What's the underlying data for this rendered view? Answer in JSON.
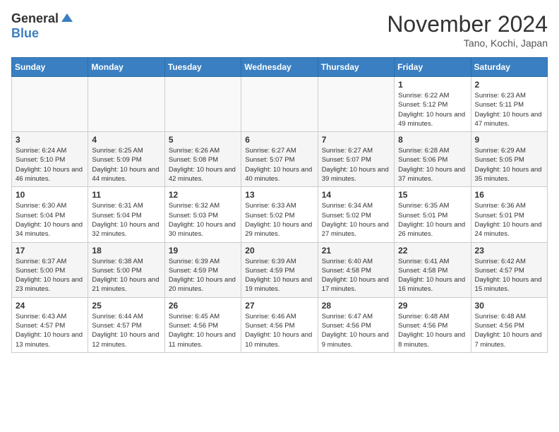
{
  "header": {
    "logo_general": "General",
    "logo_blue": "Blue",
    "month_title": "November 2024",
    "location": "Tano, Kochi, Japan"
  },
  "weekdays": [
    "Sunday",
    "Monday",
    "Tuesday",
    "Wednesday",
    "Thursday",
    "Friday",
    "Saturday"
  ],
  "weeks": [
    [
      {
        "day": "",
        "empty": true
      },
      {
        "day": "",
        "empty": true
      },
      {
        "day": "",
        "empty": true
      },
      {
        "day": "",
        "empty": true
      },
      {
        "day": "",
        "empty": true
      },
      {
        "day": "1",
        "sunrise": "6:22 AM",
        "sunset": "5:12 PM",
        "daylight": "10 hours and 49 minutes."
      },
      {
        "day": "2",
        "sunrise": "6:23 AM",
        "sunset": "5:11 PM",
        "daylight": "10 hours and 47 minutes."
      }
    ],
    [
      {
        "day": "3",
        "sunrise": "6:24 AM",
        "sunset": "5:10 PM",
        "daylight": "10 hours and 46 minutes."
      },
      {
        "day": "4",
        "sunrise": "6:25 AM",
        "sunset": "5:09 PM",
        "daylight": "10 hours and 44 minutes."
      },
      {
        "day": "5",
        "sunrise": "6:26 AM",
        "sunset": "5:08 PM",
        "daylight": "10 hours and 42 minutes."
      },
      {
        "day": "6",
        "sunrise": "6:27 AM",
        "sunset": "5:07 PM",
        "daylight": "10 hours and 40 minutes."
      },
      {
        "day": "7",
        "sunrise": "6:27 AM",
        "sunset": "5:07 PM",
        "daylight": "10 hours and 39 minutes."
      },
      {
        "day": "8",
        "sunrise": "6:28 AM",
        "sunset": "5:06 PM",
        "daylight": "10 hours and 37 minutes."
      },
      {
        "day": "9",
        "sunrise": "6:29 AM",
        "sunset": "5:05 PM",
        "daylight": "10 hours and 35 minutes."
      }
    ],
    [
      {
        "day": "10",
        "sunrise": "6:30 AM",
        "sunset": "5:04 PM",
        "daylight": "10 hours and 34 minutes."
      },
      {
        "day": "11",
        "sunrise": "6:31 AM",
        "sunset": "5:04 PM",
        "daylight": "10 hours and 32 minutes."
      },
      {
        "day": "12",
        "sunrise": "6:32 AM",
        "sunset": "5:03 PM",
        "daylight": "10 hours and 30 minutes."
      },
      {
        "day": "13",
        "sunrise": "6:33 AM",
        "sunset": "5:02 PM",
        "daylight": "10 hours and 29 minutes."
      },
      {
        "day": "14",
        "sunrise": "6:34 AM",
        "sunset": "5:02 PM",
        "daylight": "10 hours and 27 minutes."
      },
      {
        "day": "15",
        "sunrise": "6:35 AM",
        "sunset": "5:01 PM",
        "daylight": "10 hours and 26 minutes."
      },
      {
        "day": "16",
        "sunrise": "6:36 AM",
        "sunset": "5:01 PM",
        "daylight": "10 hours and 24 minutes."
      }
    ],
    [
      {
        "day": "17",
        "sunrise": "6:37 AM",
        "sunset": "5:00 PM",
        "daylight": "10 hours and 23 minutes."
      },
      {
        "day": "18",
        "sunrise": "6:38 AM",
        "sunset": "5:00 PM",
        "daylight": "10 hours and 21 minutes."
      },
      {
        "day": "19",
        "sunrise": "6:39 AM",
        "sunset": "4:59 PM",
        "daylight": "10 hours and 20 minutes."
      },
      {
        "day": "20",
        "sunrise": "6:39 AM",
        "sunset": "4:59 PM",
        "daylight": "10 hours and 19 minutes."
      },
      {
        "day": "21",
        "sunrise": "6:40 AM",
        "sunset": "4:58 PM",
        "daylight": "10 hours and 17 minutes."
      },
      {
        "day": "22",
        "sunrise": "6:41 AM",
        "sunset": "4:58 PM",
        "daylight": "10 hours and 16 minutes."
      },
      {
        "day": "23",
        "sunrise": "6:42 AM",
        "sunset": "4:57 PM",
        "daylight": "10 hours and 15 minutes."
      }
    ],
    [
      {
        "day": "24",
        "sunrise": "6:43 AM",
        "sunset": "4:57 PM",
        "daylight": "10 hours and 13 minutes."
      },
      {
        "day": "25",
        "sunrise": "6:44 AM",
        "sunset": "4:57 PM",
        "daylight": "10 hours and 12 minutes."
      },
      {
        "day": "26",
        "sunrise": "6:45 AM",
        "sunset": "4:56 PM",
        "daylight": "10 hours and 11 minutes."
      },
      {
        "day": "27",
        "sunrise": "6:46 AM",
        "sunset": "4:56 PM",
        "daylight": "10 hours and 10 minutes."
      },
      {
        "day": "28",
        "sunrise": "6:47 AM",
        "sunset": "4:56 PM",
        "daylight": "10 hours and 9 minutes."
      },
      {
        "day": "29",
        "sunrise": "6:48 AM",
        "sunset": "4:56 PM",
        "daylight": "10 hours and 8 minutes."
      },
      {
        "day": "30",
        "sunrise": "6:48 AM",
        "sunset": "4:56 PM",
        "daylight": "10 hours and 7 minutes."
      }
    ]
  ]
}
